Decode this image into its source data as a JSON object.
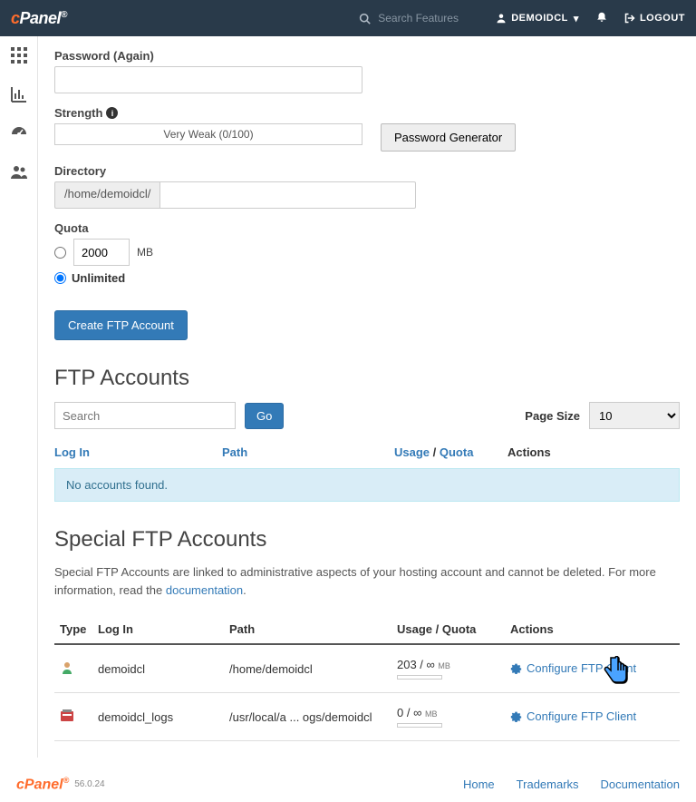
{
  "topbar": {
    "search_placeholder": "Search Features",
    "user": "DEMOIDCL",
    "logout": "LOGOUT"
  },
  "form": {
    "password_again_label": "Password (Again)",
    "password_value": "",
    "strength_label": "Strength",
    "strength_text": "Very Weak (0/100)",
    "pwgen_label": "Password Generator",
    "directory_label": "Directory",
    "directory_prefix": "/home/demoidcl/",
    "directory_value": "",
    "quota_label": "Quota",
    "quota_value": "2000",
    "quota_unit": "MB",
    "unlimited_label": "Unlimited",
    "create_btn": "Create FTP Account"
  },
  "accounts": {
    "heading": "FTP Accounts",
    "search_placeholder": "Search",
    "go": "Go",
    "page_size_label": "Page Size",
    "page_size_value": "10",
    "col_login": "Log In",
    "col_path": "Path",
    "col_usage": "Usage",
    "col_quota": "Quota",
    "slash": " / ",
    "col_actions": "Actions",
    "empty": "No accounts found."
  },
  "special": {
    "heading": "Special FTP Accounts",
    "desc_pre": "Special FTP Accounts are linked to administrative aspects of your hosting account and cannot be deleted. For more information, read the ",
    "desc_link": "documentation",
    "desc_post": ".",
    "col_type": "Type",
    "col_login": "Log In",
    "col_path": "Path",
    "col_usage": "Usage / Quota",
    "col_actions": "Actions",
    "rows": [
      {
        "login": "demoidcl",
        "path": "/home/demoidcl",
        "usage": "203 / ∞",
        "unit": "MB",
        "action": "Configure FTP Client"
      },
      {
        "login": "demoidcl_logs",
        "path": "/usr/local/a ... ogs/demoidcl",
        "usage": "0 / ∞",
        "unit": "MB",
        "action": "Configure FTP Client"
      }
    ]
  },
  "footer": {
    "version": "56.0.24",
    "links": {
      "home": "Home",
      "trademarks": "Trademarks",
      "documentation": "Documentation"
    }
  }
}
